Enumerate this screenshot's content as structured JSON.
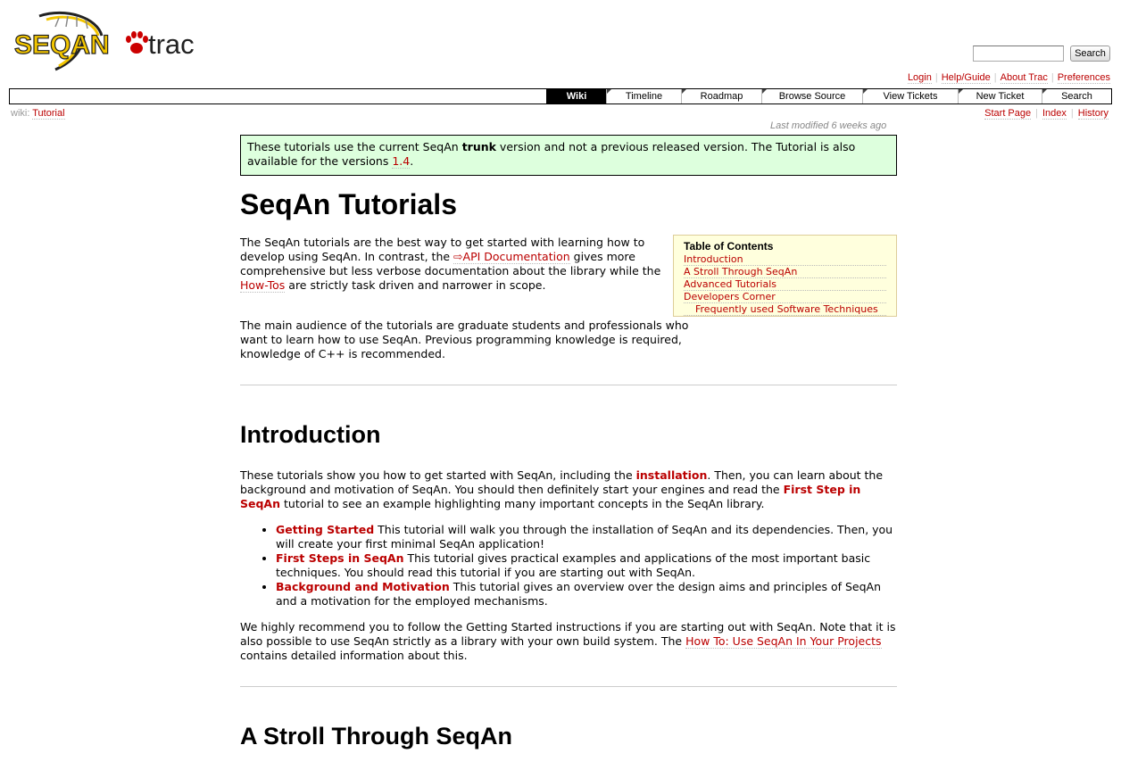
{
  "logo": {
    "seqan": "SEQAN",
    "trac": "trac"
  },
  "search": {
    "button_label": "Search",
    "value": ""
  },
  "metanav": [
    "Login",
    "Help/Guide",
    "About Trac",
    "Preferences"
  ],
  "mainnav": [
    "Wiki",
    "Timeline",
    "Roadmap",
    "Browse Source",
    "View Tickets",
    "New Ticket",
    "Search"
  ],
  "mainnav_active": "Wiki",
  "pagepath": {
    "prefix": "wiki:",
    "page": "Tutorial"
  },
  "ctxtnav": [
    "Start Page",
    "Index",
    "History"
  ],
  "last_modified": "Last modified 6 weeks ago",
  "notice": {
    "t1": "These tutorials use the current SeqAn ",
    "bold": "trunk",
    "t2": " version and not a previous released version. The Tutorial is also available for the versions ",
    "link": "1.4",
    "t3": "."
  },
  "title": "SeqAn Tutorials",
  "intro": {
    "t1": "The SeqAn tutorials are the best way to get started with learning how to develop using SeqAn. In contrast, the ",
    "link1_arrow": "⇨",
    "link1": "API Documentation",
    "t2": " gives more comprehensive but less verbose documentation about the library while the ",
    "link2": "How-Tos",
    "t3": " are strictly task driven and narrower in scope."
  },
  "audience": "The main audience of the tutorials are graduate students and professionals who want to learn how to use SeqAn. Previous programming knowledge is required, knowledge of C++ is recommended.",
  "toc": {
    "title": "Table of Contents",
    "items": [
      "Introduction",
      "A Stroll Through SeqAn",
      "Advanced Tutorials",
      "Developers Corner",
      "Frequently used Software Techniques"
    ]
  },
  "section_intro": {
    "heading": "Introduction",
    "p1": {
      "t1": "These tutorials show you how to get started with SeqAn, including the ",
      "link1": "installation",
      "t2": ". Then, you can learn about the background and motivation of SeqAn. You should then definitely start your engines and read the ",
      "link2": "First Step in SeqAn",
      "t3": " tutorial to see an example highlighting many important concepts in the SeqAn library."
    },
    "items": [
      {
        "link": "Getting Started",
        "text": " This tutorial will walk you through the installation of SeqAn and its dependencies. Then, you will create your first minimal SeqAn application!"
      },
      {
        "link": "First Steps in SeqAn",
        "text": " This tutorial gives practical examples and applications of the most important basic techniques. You should read this tutorial if you are starting out with SeqAn."
      },
      {
        "link": "Background and Motivation",
        "text": " This tutorial gives an overview over the design aims and principles of SeqAn and a motivation for the employed mechanisms."
      }
    ],
    "p2": {
      "t1": "We highly recommend you to follow the Getting Started instructions if you are starting out with SeqAn. Note that it is also possible to use SeqAn strictly as a library with your own build system. The ",
      "link": "How To: Use SeqAn In Your Projects",
      "t2": " contains detailed information about this."
    }
  },
  "section_stroll": {
    "heading": "A Stroll Through SeqAn"
  },
  "colors": {
    "link": "#bb0000",
    "notice_bg": "#ddffdd",
    "toc_bg": "#ffffdd",
    "active_tab": "#000000"
  }
}
